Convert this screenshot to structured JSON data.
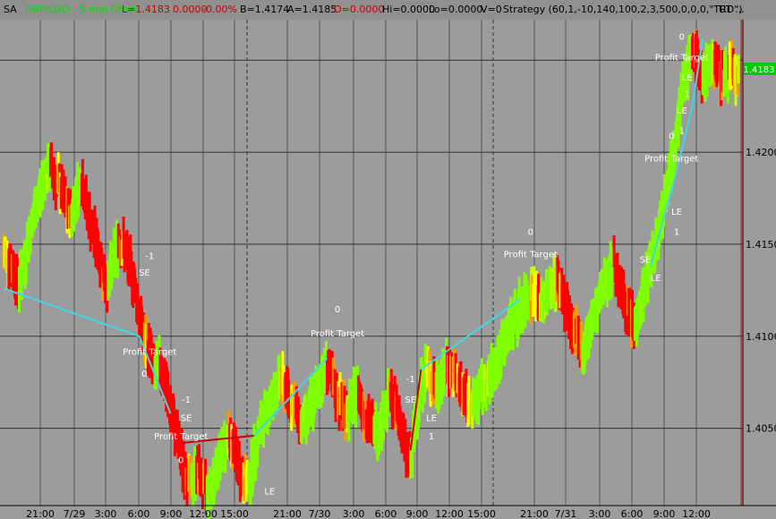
{
  "header": {
    "panel": "SA",
    "symbol": "GBP/USD - 5 min  Chart",
    "last": "L=1.4183",
    "change": "0.0000",
    "change_pct": "-0.00%",
    "bid": "B=1.4174",
    "ask": "A=1.4185",
    "open": "O=0.0000",
    "hi": "Hi=0.0000",
    "lo": "Lo=0.0000",
    "volume": "V=0",
    "strategy": "Strategy (60,1,-10,140,100,2,3,500,0,0,0,\"TRD\")",
    "ut": "UT ..."
  },
  "colors": {
    "background": "#9c9c9c",
    "up": "#7fff00",
    "mid": "#ffff00",
    "down": "#ff0000",
    "trade_line": "#3fd8e8",
    "loss_line": "#cc0000",
    "last_price_box": "#00cc00"
  },
  "price_label": "1.4183",
  "chart_data": {
    "type": "line",
    "x_ticks": [
      "21:00",
      "7/29",
      "3:00",
      "6:00",
      "9:00",
      "12:00",
      "15:00",
      "21:00",
      "7/30",
      "3:00",
      "6:00",
      "9:00",
      "12:00",
      "15:00",
      "21:00",
      "7/31",
      "3:00",
      "6:00",
      "9:00",
      "12:00"
    ],
    "y_ticks": [
      "1.4050",
      "1.4100",
      "1.4150",
      "1.4200"
    ],
    "ylim": [
      1.4008,
      1.4272
    ],
    "day_separators": [
      "7/29",
      "7/30",
      "7/31"
    ],
    "series": [
      {
        "values": [
          1.4145,
          1.4142,
          1.4135,
          1.4128,
          1.414,
          1.4155,
          1.4168,
          1.4178,
          1.4188,
          1.4192,
          1.4185,
          1.418,
          1.417,
          1.4165,
          1.4178,
          1.4185,
          1.417,
          1.4158,
          1.415,
          1.4135,
          1.4128,
          1.414,
          1.4152,
          1.4148,
          1.414,
          1.413,
          1.4112,
          1.4098,
          1.4092,
          1.408,
          1.4085,
          1.4075,
          1.406,
          1.4048,
          1.4035,
          1.4025,
          1.402,
          1.4028,
          1.4022,
          1.4015,
          1.402,
          1.403,
          1.4038,
          1.4045,
          1.404,
          1.403,
          1.4022,
          1.402,
          1.4035,
          1.4048,
          1.4055,
          1.4062,
          1.407,
          1.4075,
          1.4072,
          1.4065,
          1.406,
          1.4052,
          1.4055,
          1.4062,
          1.407,
          1.4078,
          1.4085,
          1.4075,
          1.4068,
          1.4062,
          1.4058,
          1.4065,
          1.407,
          1.406,
          1.4055,
          1.4048,
          1.4052,
          1.406,
          1.4068,
          1.4062,
          1.4055,
          1.404,
          1.403,
          1.4055,
          1.4075,
          1.408,
          1.4078,
          1.4072,
          1.4078,
          1.4085,
          1.408,
          1.4075,
          1.407,
          1.4065,
          1.4062,
          1.4068,
          1.4072,
          1.4075,
          1.4082,
          1.409,
          1.4098,
          1.4105,
          1.411,
          1.4115,
          1.412,
          1.4125,
          1.4122,
          1.4118,
          1.4122,
          1.4128,
          1.413,
          1.4125,
          1.4115,
          1.4105,
          1.4098,
          1.4092,
          1.41,
          1.411,
          1.4118,
          1.4128,
          1.4135,
          1.414,
          1.413,
          1.4118,
          1.4112,
          1.4105,
          1.4118,
          1.4128,
          1.414,
          1.415,
          1.4165,
          1.418,
          1.4195,
          1.4215,
          1.423,
          1.4245,
          1.4255,
          1.4248,
          1.424,
          1.4245,
          1.425,
          1.4245,
          1.424,
          1.4245,
          1.4242,
          1.424
        ]
      }
    ],
    "trades": [
      {
        "from": [
          0,
          1.4126
        ],
        "to": [
          26,
          1.41
        ],
        "kind": "short"
      },
      {
        "from": [
          26,
          1.41
        ],
        "to": [
          32,
          1.4058
        ],
        "kind": "short"
      },
      {
        "from": [
          34,
          1.4042
        ],
        "to": [
          48,
          1.4046
        ],
        "kind": "loss"
      },
      {
        "from": [
          48,
          1.4046
        ],
        "to": [
          62,
          1.4088
        ],
        "kind": "long"
      },
      {
        "from": [
          78,
          1.4038
        ],
        "to": [
          80,
          1.4082
        ],
        "kind": "loss"
      },
      {
        "from": [
          80,
          1.4082
        ],
        "to": [
          99,
          1.412
        ],
        "kind": "long"
      },
      {
        "from": [
          124,
          1.4138
        ],
        "to": [
          129,
          1.419
        ],
        "kind": "long"
      },
      {
        "from": [
          129,
          1.419
        ],
        "to": [
          132,
          1.4225
        ],
        "kind": "long"
      },
      {
        "from": [
          132,
          1.4225
        ],
        "to": [
          134,
          1.4262
        ],
        "kind": "long"
      }
    ],
    "annotations": [
      {
        "x": 28,
        "y": 1.4142,
        "text": "-1"
      },
      {
        "x": 27,
        "y": 1.4133,
        "text": "SE"
      },
      {
        "x": 28,
        "y": 1.409,
        "text": "Profit Target"
      },
      {
        "x": 27,
        "y": 1.4078,
        "text": "0"
      },
      {
        "x": 35,
        "y": 1.4064,
        "text": "-1"
      },
      {
        "x": 35,
        "y": 1.4054,
        "text": "SE"
      },
      {
        "x": 34,
        "y": 1.4044,
        "text": "Profit Target"
      },
      {
        "x": 34,
        "y": 1.4031,
        "text": "0"
      },
      {
        "x": 51,
        "y": 1.4014,
        "text": "LE"
      },
      {
        "x": 64,
        "y": 1.4113,
        "text": "0"
      },
      {
        "x": 64,
        "y": 1.41,
        "text": "Profit Target"
      },
      {
        "x": 78,
        "y": 1.4075,
        "text": "-1"
      },
      {
        "x": 78,
        "y": 1.4064,
        "text": "SE"
      },
      {
        "x": 82,
        "y": 1.4054,
        "text": "LE"
      },
      {
        "x": 82,
        "y": 1.4044,
        "text": "1"
      },
      {
        "x": 101,
        "y": 1.4155,
        "text": "0"
      },
      {
        "x": 101,
        "y": 1.4143,
        "text": "Profit Target"
      },
      {
        "x": 123,
        "y": 1.414,
        "text": "SE"
      },
      {
        "x": 125,
        "y": 1.413,
        "text": "LE"
      },
      {
        "x": 128,
        "y": 1.4207,
        "text": "0"
      },
      {
        "x": 128,
        "y": 1.4195,
        "text": "Profit Target"
      },
      {
        "x": 129,
        "y": 1.4166,
        "text": "LE"
      },
      {
        "x": 129,
        "y": 1.4155,
        "text": "1"
      },
      {
        "x": 130,
        "y": 1.4221,
        "text": "LE"
      },
      {
        "x": 130,
        "y": 1.421,
        "text": "1"
      },
      {
        "x": 130,
        "y": 1.4261,
        "text": "0"
      },
      {
        "x": 130,
        "y": 1.425,
        "text": "Profit Target"
      },
      {
        "x": 131,
        "y": 1.4239,
        "text": "LE"
      },
      {
        "x": 131,
        "y": 1.423,
        "text": "1"
      }
    ]
  }
}
